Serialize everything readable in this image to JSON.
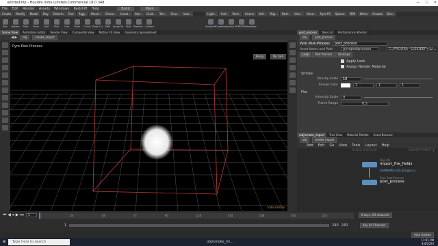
{
  "window": {
    "title": "untitled.hip - Houdini Indie Limited-Commercial 18.0.348"
  },
  "menu": [
    "File",
    "Edit",
    "Render",
    "Assets",
    "Windows",
    "Redshift",
    "Help"
  ],
  "desktop": {
    "label": "Build",
    "main": "Main"
  },
  "shelf_tabs_left": [
    "Create",
    "Modify",
    "Model",
    "Poly",
    "Deform",
    "Text",
    "Rigg..",
    "Muscl..",
    "Chara..",
    "Const..",
    "Hair..",
    "Guid..",
    "Terr..",
    "Clou..",
    "Volu.."
  ],
  "shelf_tabs_right": [
    "Light..",
    "Coll..",
    "Parti..",
    "Grains",
    "Vell..",
    "Rigi..",
    "Parti..",
    "Visc..",
    "Ocea..",
    "Pyro FX",
    "Sparse",
    "FEM",
    "Wires",
    "Crowds",
    "Driv.."
  ],
  "shelf_tools_left": [
    "Box",
    "Sphere",
    "Tube",
    "Torus",
    "Grid",
    "Null",
    "Line",
    "Circle",
    "Curve",
    "Draw Curve",
    "Path",
    "Spray Paint",
    "Font",
    "Platonic Solids",
    "L-System"
  ],
  "shelf_tools_right": [
    "Sparse Billowy Sm...",
    "Combine",
    "Sparse Smoke",
    "GPU Billowy Smoke",
    "Spreading Fire"
  ],
  "viewer_tabs": [
    "Scene View",
    "Animation Editor",
    "Render View",
    "Composite View",
    "Motion FX View",
    "Geometry Spreadsheet"
  ],
  "viewer_path": {
    "obj": "obj",
    "node": "smoke_import"
  },
  "viewer": {
    "title": "Pyro Post-Process",
    "persp": "Persp",
    "cam": "No cam",
    "edition": "Indie Edition"
  },
  "right_tabs": [
    "post_process",
    "Take List",
    "Performance Monitor"
  ],
  "params": {
    "path_obj": "obj",
    "path_node": "post_process",
    "node_type": "Pyro Post-Process",
    "node_name": "post_process",
    "asset_label": "Asset Name and Path",
    "asset_value": "pyropostprocess",
    "asset_path": "C:/PROGRA~1/SIDEEF~1/...",
    "tabs": [
      "Look",
      "Post Process",
      "Bindings"
    ],
    "apply_look": "Apply Look",
    "assign_material": "Assign Render Material",
    "smoke_heading": "Smoke",
    "density_label": "Density Scale",
    "density_value": "10",
    "color_label": "Smoke Color",
    "color_r": "1",
    "color_g": "1",
    "color_b": "1",
    "fire_heading": "Fire",
    "intensity_label": "Intensity Scale",
    "intensity_value": "0",
    "flame_label": "Flame Range",
    "flame_value": "0.5"
  },
  "net_tabs": [
    "/obj/smoke_import",
    "Tree View",
    "Material Palette",
    "Asset Browser"
  ],
  "net_path": {
    "obj": "obj",
    "node": "smoke_import"
  },
  "net_menu": [
    "Add",
    "Edit",
    "Go",
    "View",
    "Tools",
    "Layout",
    "Help"
  ],
  "net_watermark": {
    "edition": "Indie Edition",
    "context": "Geometry"
  },
  "net_nodes": [
    {
      "type": "Dop I/O",
      "name": "import_fire_fields",
      "sub": "$HIPNAME.$OS.$F.bgeo.sc",
      "color": "#5d8fbf"
    },
    {
      "type": "Pyro Post-Process",
      "name": "post_process",
      "color": "#5d8fbf"
    }
  ],
  "timeline": {
    "frame": "1",
    "start": "1",
    "end": "240",
    "end2": "240",
    "ticks": [
      "24",
      "48",
      "72",
      "96",
      "120",
      "144",
      "168",
      "192",
      "216"
    ],
    "keys": "0 keys, 0/0 channels",
    "all_channels": "Key All Channels",
    "auto_update": "Auto Update",
    "play_pos": 0.0
  },
  "taskbar": {
    "search": "Type here to search",
    "time": "11:01 PM",
    "date": "4/4/2020",
    "app": "obj/smoke_im..."
  },
  "colors": {
    "bg": "#3a3a3a",
    "viewport": "#000000",
    "grid": "#5a5a5a",
    "box": "#c23a3a",
    "accent": "#e0a030"
  }
}
